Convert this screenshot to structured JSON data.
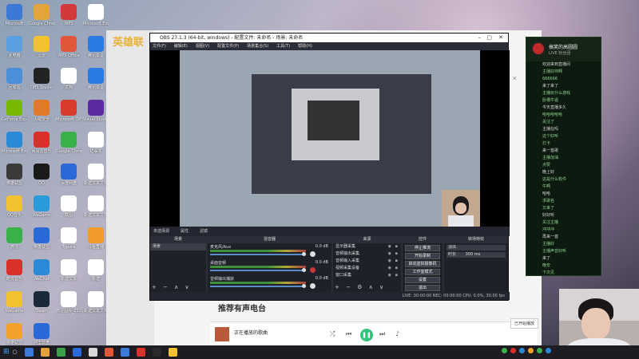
{
  "desktop_icons": [
    {
      "label": "Microsoft",
      "color": "#3b78d8"
    },
    {
      "label": "Google Chrome",
      "color": "#e3a43a"
    },
    {
      "label": "WPS",
      "color": "#d23a3a"
    },
    {
      "label": "Microsoft Edge",
      "color": "#ffffff"
    },
    {
      "label": "此电脑",
      "color": "#5aa0e0"
    },
    {
      "label": "迅雷",
      "color": "#f2c230"
    },
    {
      "label": "WPS Office",
      "color": "#e2573a"
    },
    {
      "label": "腾讯会议",
      "color": "#2a7ae2"
    },
    {
      "label": "回收站",
      "color": "#4a90d8"
    },
    {
      "label": "OBS Studio",
      "color": "#222222"
    },
    {
      "label": "文档",
      "color": "#ffffff"
    },
    {
      "label": "腾讯会议",
      "color": "#2a7ae2"
    },
    {
      "label": "GeForce Experience",
      "color": "#76b900"
    },
    {
      "label": "火绒安全",
      "color": "#e07a2a"
    },
    {
      "label": "Microsoft Office",
      "color": "#d83b2a"
    },
    {
      "label": "Visual Studio",
      "color": "#5a2aa0"
    },
    {
      "label": "Microsoft Edge",
      "color": "#2a8ad8"
    },
    {
      "label": "网易云音乐",
      "color": "#d8302a"
    },
    {
      "label": "Google Chrome",
      "color": "#3ab04a"
    },
    {
      "label": "记事本",
      "color": "#ffffff"
    },
    {
      "label": "英雄联盟",
      "color": "#3a3a3a"
    },
    {
      "label": "QQ",
      "color": "#1a1a1a"
    },
    {
      "label": "百度网盘",
      "color": "#2a6ad8"
    },
    {
      "label": "新建文本文档",
      "color": "#ffffff"
    },
    {
      "label": "QQ音乐",
      "color": "#f2c230"
    },
    {
      "label": "WeGame",
      "color": "#2a9ad8"
    },
    {
      "label": "截图",
      "color": "#ffffff"
    },
    {
      "label": "新建文本文档",
      "color": "#ffffff"
    },
    {
      "label": "微信",
      "color": "#3ab04a"
    },
    {
      "label": "英雄联盟",
      "color": "#2a6ad8"
    },
    {
      "label": "Typora",
      "color": "#ffffff"
    },
    {
      "label": "斗鱼直播",
      "color": "#f29a2a"
    },
    {
      "label": "酷狗音乐",
      "color": "#d8302a"
    },
    {
      "label": "WeChat",
      "color": "#2a8ad8"
    },
    {
      "label": "新建文本",
      "color": "#ffffff"
    },
    {
      "label": "新建",
      "color": "#ffffff"
    },
    {
      "label": "WeGame",
      "color": "#f2c230"
    },
    {
      "label": "Steam",
      "color": "#1a2a3a"
    },
    {
      "label": "微信图片_2022",
      "color": "#ffffff"
    },
    {
      "label": "新建文本文档",
      "color": "#ffffff"
    },
    {
      "label": "英雄联盟",
      "color": "#f2a22a"
    },
    {
      "label": "阿里云盘",
      "color": "#2a6ad8"
    },
    {
      "label": "",
      "color": "transparent"
    },
    {
      "label": "",
      "color": "transparent"
    }
  ],
  "music_app": {
    "logo": "英雄联",
    "section_title": "推荐有声电台",
    "song_title": "正在播放的歌曲",
    "toast": "已开始播放"
  },
  "obs": {
    "title": "OBS 27.1.3 (64-bit, windows) - 配置文件: 未命名 - 场景: 未命名",
    "menu": [
      "文件(F)",
      "编辑(E)",
      "视图(V)",
      "配置文件(P)",
      "场景集合(S)",
      "工具(T)",
      "帮助(H)"
    ],
    "status_row": [
      "未选择源",
      "属性",
      "滤镜"
    ],
    "panels": {
      "scenes": {
        "header": "场景",
        "items": [
          "场景"
        ]
      },
      "mixer": {
        "header": "混音器",
        "tracks": [
          {
            "name": "麦克风/Aux",
            "db": "0.0 dB",
            "mute_color": "#dddddd"
          },
          {
            "name": "桌面音频",
            "db": "0.0 dB",
            "mute_color": "#c83a3a"
          },
          {
            "name": "音频输出捕获",
            "db": "0.0 dB",
            "mute_color": "#dddddd"
          }
        ]
      },
      "sources": {
        "header": "来源",
        "items": [
          "显示器采集",
          "音频输出采集",
          "音频输入采集",
          "视频采集设备",
          "窗口采集"
        ]
      },
      "controls": {
        "header": "控件",
        "items": [
          "停止推流",
          "开始录制",
          "启动虚拟摄像机",
          "工作室模式",
          "设置",
          "退出"
        ]
      },
      "transitions": {
        "header": "转场特效",
        "field": "淡出",
        "duration_label": "时长",
        "duration": "300 ms"
      }
    },
    "bottom_status": "LIVE: 00:00:00   REC: 00:00:00   CPU: 0.0%, 30.00 fps"
  },
  "chat": {
    "streamer_name": "搞笑的高圆圆",
    "room_info": "LIVE 粉丝团",
    "messages": [
      {
        "text": "欢迎来到直播间",
        "white": true
      },
      {
        "text": "主播好帅啊",
        "white": false
      },
      {
        "text": "666666",
        "white": false
      },
      {
        "text": "来了来了",
        "white": true
      },
      {
        "text": "主播玩什么游戏",
        "white": false
      },
      {
        "text": "卧槽牛逼",
        "white": false
      },
      {
        "text": "今天直播多久",
        "white": true
      },
      {
        "text": "哈哈哈哈哈",
        "white": false
      },
      {
        "text": "关注了",
        "white": false
      },
      {
        "text": "主播在吗",
        "white": true
      },
      {
        "text": "这个好听",
        "white": false
      },
      {
        "text": "打卡",
        "white": false
      },
      {
        "text": "来一首歌",
        "white": true
      },
      {
        "text": "主播加油",
        "white": false
      },
      {
        "text": "点赞",
        "white": false
      },
      {
        "text": "晚上好",
        "white": true
      },
      {
        "text": "这是什么软件",
        "white": false
      },
      {
        "text": "牛啊",
        "white": false
      },
      {
        "text": "哈哈",
        "white": true
      },
      {
        "text": "求歌名",
        "white": false
      },
      {
        "text": "又来了",
        "white": false
      },
      {
        "text": "好好听",
        "white": true
      },
      {
        "text": "关注主播",
        "white": false
      },
      {
        "text": "冲冲冲",
        "white": false
      },
      {
        "text": "再来一首",
        "white": true
      },
      {
        "text": "主播好",
        "white": false
      },
      {
        "text": "主播声音好听",
        "white": false
      },
      {
        "text": "来了",
        "white": true
      },
      {
        "text": "晚安",
        "white": false
      },
      {
        "text": "下次见",
        "white": false
      }
    ]
  },
  "taskbar": {
    "icons": [
      "#3a7ad8",
      "#e2a33a",
      "#3aa04a",
      "#2a6ad8",
      "#d8d8d8",
      "#e2573a",
      "#3a7ad8",
      "#d8302a",
      "#2a2a2a",
      "#f2c230"
    ],
    "tray_colors": [
      "#3ab04a",
      "#d8302a",
      "#2a8ad8",
      "#f2a22a",
      "#3ab04a",
      "#2a8ad8"
    ]
  }
}
